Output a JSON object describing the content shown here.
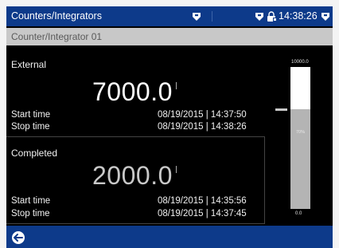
{
  "header": {
    "title": "Counters/Integrators",
    "time": "14:38:26"
  },
  "subheader": {
    "label": "Counter/Integrator 01"
  },
  "counters": [
    {
      "name": "External",
      "value": "7000.0",
      "start_label": "Start time",
      "start_value": "08/19/2015 | 14:37:50",
      "stop_label": "Stop time",
      "stop_value": "08/19/2015 | 14:38:26"
    },
    {
      "name": "Completed",
      "value": "2000.0",
      "start_label": "Start time",
      "start_value": "08/19/2015 | 14:35:56",
      "stop_label": "Stop time",
      "stop_value": "08/19/2015 | 14:37:45"
    }
  ],
  "bargraph": {
    "max_label": "10000.0",
    "min_label": "0.0",
    "percent_label": "70%",
    "fill_fraction": 0.7,
    "marker_fraction": 0.7
  },
  "colors": {
    "title_bar": "#0d3a8a",
    "subheader": "#c8c8c8",
    "screen_bg": "#000000",
    "bar_track": "#ffffff",
    "bar_fill": "#b4b4b4"
  },
  "icons": {
    "alarm": "shield-flag-icon",
    "lock": "lock-icon",
    "back": "back-arrow-icon"
  }
}
